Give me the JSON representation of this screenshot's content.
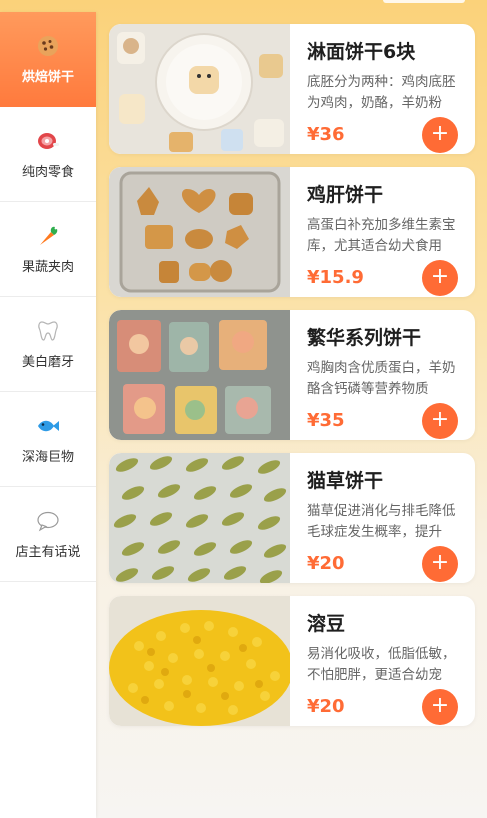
{
  "sidebar": {
    "items": [
      {
        "label": "烘焙饼干",
        "icon": "cookie-icon",
        "active": true
      },
      {
        "label": "纯肉零食",
        "icon": "meat-icon",
        "active": false
      },
      {
        "label": "果蔬夹肉",
        "icon": "carrot-icon",
        "active": false
      },
      {
        "label": "美白磨牙",
        "icon": "tooth-icon",
        "active": false
      },
      {
        "label": "深海巨物",
        "icon": "fish-icon",
        "active": false
      },
      {
        "label": "店主有话说",
        "icon": "chat-bubble-icon",
        "active": false
      }
    ]
  },
  "products": [
    {
      "title": "淋面饼干6块",
      "desc": "底胚分为两种：鸡肉底胚为鸡肉，奶酪，羊奶粉",
      "price": "¥36",
      "add_label": "+"
    },
    {
      "title": "鸡肝饼干",
      "desc": "高蛋白补充加多维生素宝库，尤其适合幼犬食用",
      "price": "¥15.9",
      "add_label": "+"
    },
    {
      "title": "繁华系列饼干",
      "desc": "鸡胸肉含优质蛋白，羊奶酪含钙磷等营养物质",
      "price": "¥35",
      "add_label": "+"
    },
    {
      "title": "猫草饼干",
      "desc": "猫草促进消化与排毛降低毛球症发生概率，提升",
      "price": "¥20",
      "add_label": "+"
    },
    {
      "title": "溶豆",
      "desc": "易消化吸收，低脂低敏，不怕肥胖，更适合幼宠",
      "price": "¥20",
      "add_label": "+"
    }
  ],
  "colors": {
    "accent": "#ff6b35",
    "sidebar_active": "#ff8a4a",
    "background_top": "#fbd27a"
  }
}
